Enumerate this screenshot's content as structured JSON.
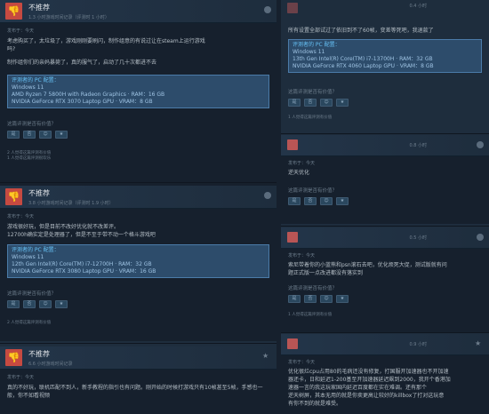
{
  "left": {
    "reviews": [
      {
        "verdict": "不推荐",
        "hours": "1.3 小时游戏时间记录（评测时 1 小时）",
        "date": "发布于：今天",
        "body_lines": [
          "考虑购买了，太垃圾了，游戏刚刚要刷闪，制作组意的有说过让在steam上运行游戏",
          "吗?",
          "",
          "制作组你们的亲妈暴毙了，真的服气了，启动了几十次都进不去"
        ],
        "spec_title": "评测者的 PC 配置：",
        "spec_lines": [
          "Windows 11",
          "AMD Ryzen 7 5800H with Radeon Graphics · RAM：16 GB",
          "NVIDIA GeForce RTX 3070 Laptop GPU · VRAM：8 GB"
        ],
        "helpful_q": "这篇评测是否有价值？",
        "votes": [
          "2 人觉得这篇评测有价值",
          "1 人觉得这篇评测很欢乐"
        ]
      },
      {
        "verdict": "不推荐",
        "hours": "3.8 小时游戏时间记录（评测时 1.9 小时）",
        "date": "发布于：今天",
        "body_lines": [
          "游戏很好玩，但是目前不改好优化就不改差评。",
          "12700h确实定是处理器了，但是不至于带不动一个格斗游戏吧"
        ],
        "spec_title": "评测者的 PC 配置：",
        "spec_lines": [
          "Windows 11",
          "12th Gen Intel(R) Core(TM) i7-12700H · RAM：32 GB",
          "NVIDIA GeForce RTX 3080 Laptop GPU · VRAM：16 GB"
        ],
        "helpful_q": "这篇评测是否有价值？",
        "votes": [
          "2 人觉得这篇评测有价值"
        ]
      },
      {
        "verdict": "不推荐",
        "hours": "6.6 小时游戏时间记录",
        "date": "发布于：今天",
        "body_lines": [
          "真的不好玩，联机匹配不到人，新手教程的指引也有问题。刚开始的时候打游戏只有10帧甚至5帧，手感也一般，你不如看视频"
        ]
      }
    ]
  },
  "right": {
    "reviews": [
      {
        "time": "0.4 小时",
        "body_lines": [
          "所有设置全部试过了依旧到不了60帧，变差等死吧，我退款了"
        ],
        "spec_title": "评测者的 PC 配置：",
        "spec_lines": [
          "Windows 11",
          "13th Gen Intel(R) Core(TM) i7-13700H · RAM：32 GB",
          "NVIDIA GeForce RTX 4060 Laptop GPU · VRAM：8 GB"
        ],
        "helpful_q": "这篇评测是否有价值？",
        "votes": [
          "1 人觉得这篇评测有价值"
        ]
      },
      {
        "time": "0.8 小时",
        "date": "发布于：今天",
        "body_lines": [
          "逆天优化"
        ],
        "helpful_q": "这篇评测是否有价值？",
        "votes": []
      },
      {
        "time": "0.5 小时",
        "date": "发布于：今天",
        "body_lines": [
          "索尼带着你的小蓝熊和psn滚石去吧，优化烦死大促，测试版就有问",
          "题正式版一点改进都没有落实到"
        ],
        "helpful_q": "这篇评测是否有价值？",
        "votes": [
          "1 人觉得这篇评测有价值"
        ]
      },
      {
        "time": "0.9 小时",
        "date": "发布于：今天",
        "body_lines": [
          "优化很烂cpu占用80的毛病还没有修复，打国服开加速器也不开加速",
          "器还卡，日和延迟1-200基至开加速器延迟飙到2000，我开个香港加",
          "速器一言的我这玩家国内延迟百度都在实在难调。还有那个",
          "逆天树屏，其本无用的就是你卖更高让较好的killbox了打对这玩意",
          "有你不到的就是难受。"
        ]
      }
    ]
  },
  "buttons": {
    "yes": "是",
    "no": "否",
    "funny": "☺",
    "award": "★"
  },
  "colors": {
    "negative": "#c64a41",
    "spec_bg": "#2d4c6b",
    "accent": "#66c0f4"
  }
}
